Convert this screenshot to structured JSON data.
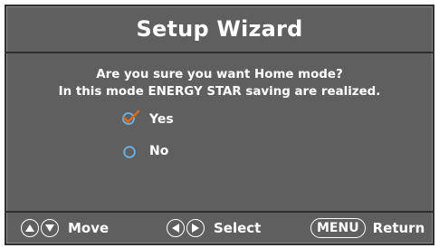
{
  "dialog": {
    "title": "Setup Wizard",
    "question_line1": "Are you sure you want Home mode?",
    "question_line2": "In this mode ENERGY STAR saving are realized."
  },
  "options": [
    {
      "label": "Yes",
      "selected": true
    },
    {
      "label": "No",
      "selected": false
    }
  ],
  "footer": {
    "move_label": "Move",
    "select_label": "Select",
    "menu_key": "MENU",
    "return_label": "Return"
  },
  "colors": {
    "panel_bg": "#5f5f5f",
    "border": "#2e2e2e",
    "text": "#ffffff",
    "check_accent": "#e06a1a",
    "radio_blue": "#6ab4e8"
  },
  "icons": {
    "up": "up-arrow-icon",
    "down": "down-arrow-icon",
    "left": "left-arrow-icon",
    "right": "right-arrow-icon",
    "checked": "check-icon",
    "radio": "radio-circle-icon"
  }
}
